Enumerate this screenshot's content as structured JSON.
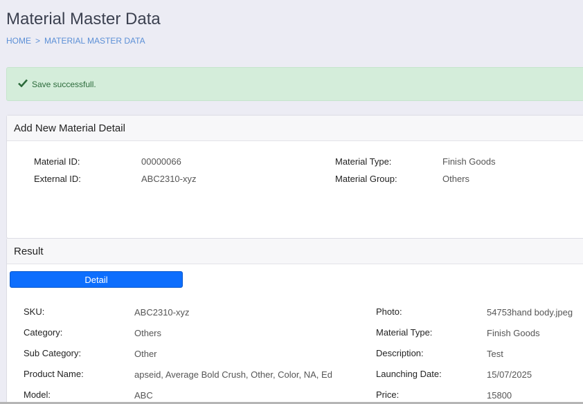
{
  "page": {
    "title": "Material Master Data"
  },
  "breadcrumb": {
    "home": "HOME",
    "sep": ">",
    "current": "MATERIAL MASTER DATA"
  },
  "alert": {
    "message": "Save successfull.",
    "icon": "check-icon"
  },
  "add_card": {
    "title": "Add New Material Detail",
    "fields": {
      "material_id_label": "Material ID:",
      "material_id_value": "00000066",
      "external_id_label": "External ID:",
      "external_id_value": "ABC2310-xyz",
      "material_type_label": "Material Type:",
      "material_type_value": "Finish Goods",
      "material_group_label": "Material Group:",
      "material_group_value": "Others"
    }
  },
  "result_card": {
    "title": "Result",
    "detail_button": "Detail",
    "left": [
      {
        "label": "SKU:",
        "value": "ABC2310-xyz"
      },
      {
        "label": "Category:",
        "value": "Others"
      },
      {
        "label": "Sub Category:",
        "value": "Other"
      },
      {
        "label": "Product Name:",
        "value": "apseid, Average Bold Crush, Other, Color, NA, Ed"
      },
      {
        "label": "Model:",
        "value": "ABC"
      }
    ],
    "right": [
      {
        "label": "Photo:",
        "value": "54753hand body.jpeg"
      },
      {
        "label": "Material Type:",
        "value": "Finish Goods"
      },
      {
        "label": "Description:",
        "value": "Test"
      },
      {
        "label": "Launching Date:",
        "value": "15/07/2025"
      },
      {
        "label": "Price:",
        "value": "15800"
      }
    ]
  }
}
